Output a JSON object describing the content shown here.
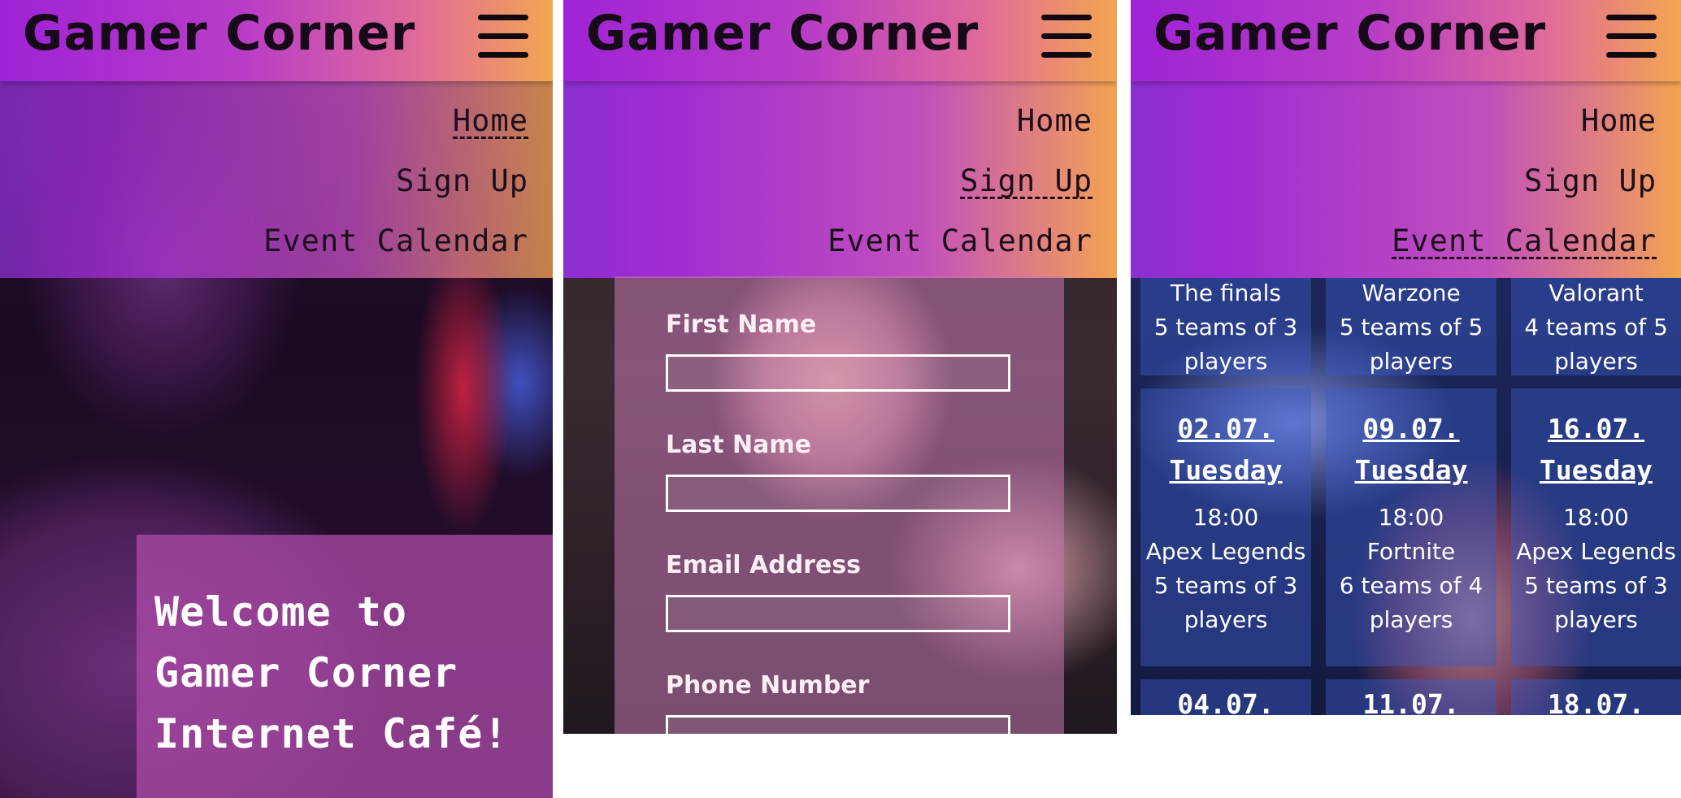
{
  "site": {
    "brand": "Gamer Corner"
  },
  "nav": {
    "items": [
      "Home",
      "Sign Up",
      "Event Calendar"
    ]
  },
  "home": {
    "welcome_lines": [
      "Welcome to",
      "Gamer Corner",
      "Internet Café!"
    ]
  },
  "signup": {
    "fields": [
      "First Name",
      "Last Name",
      "Email Address",
      "Phone Number"
    ]
  },
  "calendar": {
    "prev_row": [
      {
        "game": "The finals",
        "teams": "5 teams of 3",
        "unit": "players"
      },
      {
        "game": "Warzone",
        "teams": "5 teams of 5",
        "unit": "players"
      },
      {
        "game": "Valorant",
        "teams": "4 teams of 5",
        "unit": "players"
      }
    ],
    "row": [
      {
        "date": "02.07.",
        "day": "Tuesday",
        "time": "18:00",
        "game": "Apex Legends",
        "teams": "5 teams of 3",
        "unit": "players"
      },
      {
        "date": "09.07.",
        "day": "Tuesday",
        "time": "18:00",
        "game": "Fortnite",
        "teams": "6 teams of 4",
        "unit": "players"
      },
      {
        "date": "16.07.",
        "day": "Tuesday",
        "time": "18:00",
        "game": "Apex Legends",
        "teams": "5 teams of 3",
        "unit": "players"
      }
    ],
    "next_row_dates": [
      "04.07.",
      "11.07.",
      "18.07."
    ]
  },
  "colors": {
    "header_start": "#9f22d6",
    "header_end": "#f3a650",
    "text_dark": "#160a18",
    "overlay_pink": "#b04caa",
    "calendar_cell": "#3c5ac8"
  },
  "icons": {
    "menu": "hamburger-menu-icon"
  }
}
